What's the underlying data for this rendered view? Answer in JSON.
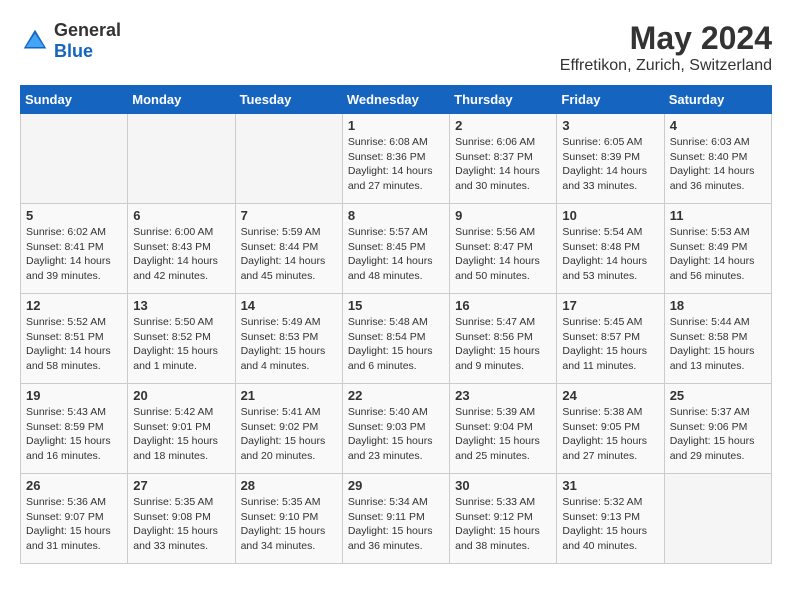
{
  "logo": {
    "general": "General",
    "blue": "Blue"
  },
  "title": "May 2024",
  "subtitle": "Effretikon, Zurich, Switzerland",
  "weekdays": [
    "Sunday",
    "Monday",
    "Tuesday",
    "Wednesday",
    "Thursday",
    "Friday",
    "Saturday"
  ],
  "weeks": [
    [
      {
        "day": "",
        "info": ""
      },
      {
        "day": "",
        "info": ""
      },
      {
        "day": "",
        "info": ""
      },
      {
        "day": "1",
        "info": "Sunrise: 6:08 AM\nSunset: 8:36 PM\nDaylight: 14 hours\nand 27 minutes."
      },
      {
        "day": "2",
        "info": "Sunrise: 6:06 AM\nSunset: 8:37 PM\nDaylight: 14 hours\nand 30 minutes."
      },
      {
        "day": "3",
        "info": "Sunrise: 6:05 AM\nSunset: 8:39 PM\nDaylight: 14 hours\nand 33 minutes."
      },
      {
        "day": "4",
        "info": "Sunrise: 6:03 AM\nSunset: 8:40 PM\nDaylight: 14 hours\nand 36 minutes."
      }
    ],
    [
      {
        "day": "5",
        "info": "Sunrise: 6:02 AM\nSunset: 8:41 PM\nDaylight: 14 hours\nand 39 minutes."
      },
      {
        "day": "6",
        "info": "Sunrise: 6:00 AM\nSunset: 8:43 PM\nDaylight: 14 hours\nand 42 minutes."
      },
      {
        "day": "7",
        "info": "Sunrise: 5:59 AM\nSunset: 8:44 PM\nDaylight: 14 hours\nand 45 minutes."
      },
      {
        "day": "8",
        "info": "Sunrise: 5:57 AM\nSunset: 8:45 PM\nDaylight: 14 hours\nand 48 minutes."
      },
      {
        "day": "9",
        "info": "Sunrise: 5:56 AM\nSunset: 8:47 PM\nDaylight: 14 hours\nand 50 minutes."
      },
      {
        "day": "10",
        "info": "Sunrise: 5:54 AM\nSunset: 8:48 PM\nDaylight: 14 hours\nand 53 minutes."
      },
      {
        "day": "11",
        "info": "Sunrise: 5:53 AM\nSunset: 8:49 PM\nDaylight: 14 hours\nand 56 minutes."
      }
    ],
    [
      {
        "day": "12",
        "info": "Sunrise: 5:52 AM\nSunset: 8:51 PM\nDaylight: 14 hours\nand 58 minutes."
      },
      {
        "day": "13",
        "info": "Sunrise: 5:50 AM\nSunset: 8:52 PM\nDaylight: 15 hours\nand 1 minute."
      },
      {
        "day": "14",
        "info": "Sunrise: 5:49 AM\nSunset: 8:53 PM\nDaylight: 15 hours\nand 4 minutes."
      },
      {
        "day": "15",
        "info": "Sunrise: 5:48 AM\nSunset: 8:54 PM\nDaylight: 15 hours\nand 6 minutes."
      },
      {
        "day": "16",
        "info": "Sunrise: 5:47 AM\nSunset: 8:56 PM\nDaylight: 15 hours\nand 9 minutes."
      },
      {
        "day": "17",
        "info": "Sunrise: 5:45 AM\nSunset: 8:57 PM\nDaylight: 15 hours\nand 11 minutes."
      },
      {
        "day": "18",
        "info": "Sunrise: 5:44 AM\nSunset: 8:58 PM\nDaylight: 15 hours\nand 13 minutes."
      }
    ],
    [
      {
        "day": "19",
        "info": "Sunrise: 5:43 AM\nSunset: 8:59 PM\nDaylight: 15 hours\nand 16 minutes."
      },
      {
        "day": "20",
        "info": "Sunrise: 5:42 AM\nSunset: 9:01 PM\nDaylight: 15 hours\nand 18 minutes."
      },
      {
        "day": "21",
        "info": "Sunrise: 5:41 AM\nSunset: 9:02 PM\nDaylight: 15 hours\nand 20 minutes."
      },
      {
        "day": "22",
        "info": "Sunrise: 5:40 AM\nSunset: 9:03 PM\nDaylight: 15 hours\nand 23 minutes."
      },
      {
        "day": "23",
        "info": "Sunrise: 5:39 AM\nSunset: 9:04 PM\nDaylight: 15 hours\nand 25 minutes."
      },
      {
        "day": "24",
        "info": "Sunrise: 5:38 AM\nSunset: 9:05 PM\nDaylight: 15 hours\nand 27 minutes."
      },
      {
        "day": "25",
        "info": "Sunrise: 5:37 AM\nSunset: 9:06 PM\nDaylight: 15 hours\nand 29 minutes."
      }
    ],
    [
      {
        "day": "26",
        "info": "Sunrise: 5:36 AM\nSunset: 9:07 PM\nDaylight: 15 hours\nand 31 minutes."
      },
      {
        "day": "27",
        "info": "Sunrise: 5:35 AM\nSunset: 9:08 PM\nDaylight: 15 hours\nand 33 minutes."
      },
      {
        "day": "28",
        "info": "Sunrise: 5:35 AM\nSunset: 9:10 PM\nDaylight: 15 hours\nand 34 minutes."
      },
      {
        "day": "29",
        "info": "Sunrise: 5:34 AM\nSunset: 9:11 PM\nDaylight: 15 hours\nand 36 minutes."
      },
      {
        "day": "30",
        "info": "Sunrise: 5:33 AM\nSunset: 9:12 PM\nDaylight: 15 hours\nand 38 minutes."
      },
      {
        "day": "31",
        "info": "Sunrise: 5:32 AM\nSunset: 9:13 PM\nDaylight: 15 hours\nand 40 minutes."
      },
      {
        "day": "",
        "info": ""
      }
    ]
  ]
}
